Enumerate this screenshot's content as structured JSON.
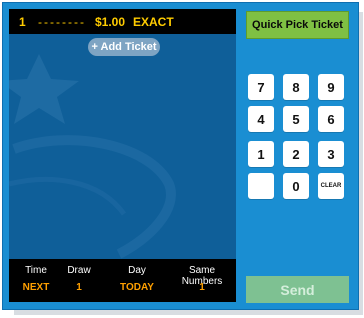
{
  "ticket": {
    "line_number": "1",
    "numbers_placeholder": "--------",
    "amount": "$1.00",
    "bet_type": "EXACT"
  },
  "add_ticket_label": "+ Add Ticket",
  "footer": {
    "headers": [
      "Time",
      "Draw",
      "Day",
      "Same Numbers"
    ],
    "values": [
      "NEXT",
      "1",
      "TODAY",
      "1"
    ]
  },
  "quick_pick_label": "Quick Pick Ticket",
  "keypad": {
    "keys": [
      "7",
      "8",
      "9",
      "4",
      "5",
      "6",
      "1",
      "2",
      "3",
      "",
      "0",
      "CLEAR"
    ]
  },
  "send_label": "Send",
  "colors": {
    "frame": "#1a8ed2",
    "panel": "#0f5f99",
    "accent_yellow": "#ffcc00",
    "accent_orange": "#ffa000",
    "quick_pick_green": "#7fc043",
    "send_green_disabled": "#7ec192"
  }
}
